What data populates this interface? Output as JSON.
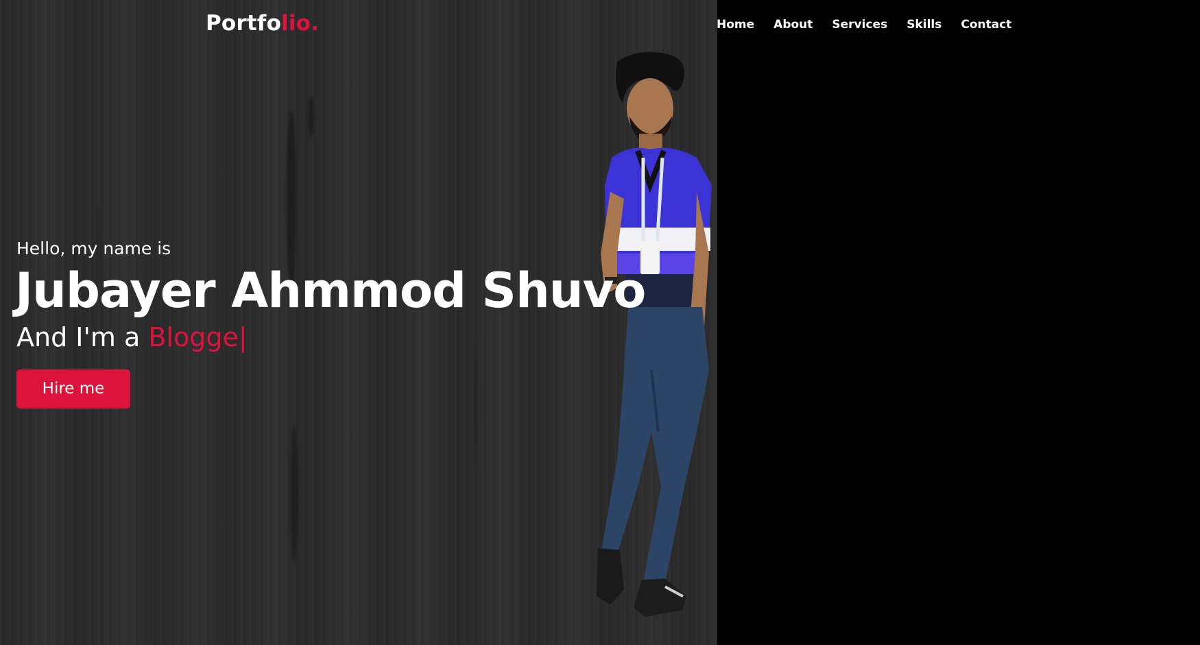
{
  "navbar": {
    "logo_main": "Portfo",
    "logo_accent": "lio.",
    "items": [
      {
        "label": "Home"
      },
      {
        "label": "About"
      },
      {
        "label": "Services"
      },
      {
        "label": "Skills"
      },
      {
        "label": "Contact"
      }
    ]
  },
  "hero": {
    "greeting": "Hello, my name is",
    "name": "Jubayer Ahmmod Shuvo",
    "role_prefix": "And I'm a ",
    "role_typed": "Blogge",
    "cursor": "|",
    "hire_button_label": "Hire me"
  },
  "colors": {
    "accent": "#dc143c",
    "panel_background": "#2c2c2c",
    "page_background": "#000000",
    "text": "#ffffff"
  }
}
